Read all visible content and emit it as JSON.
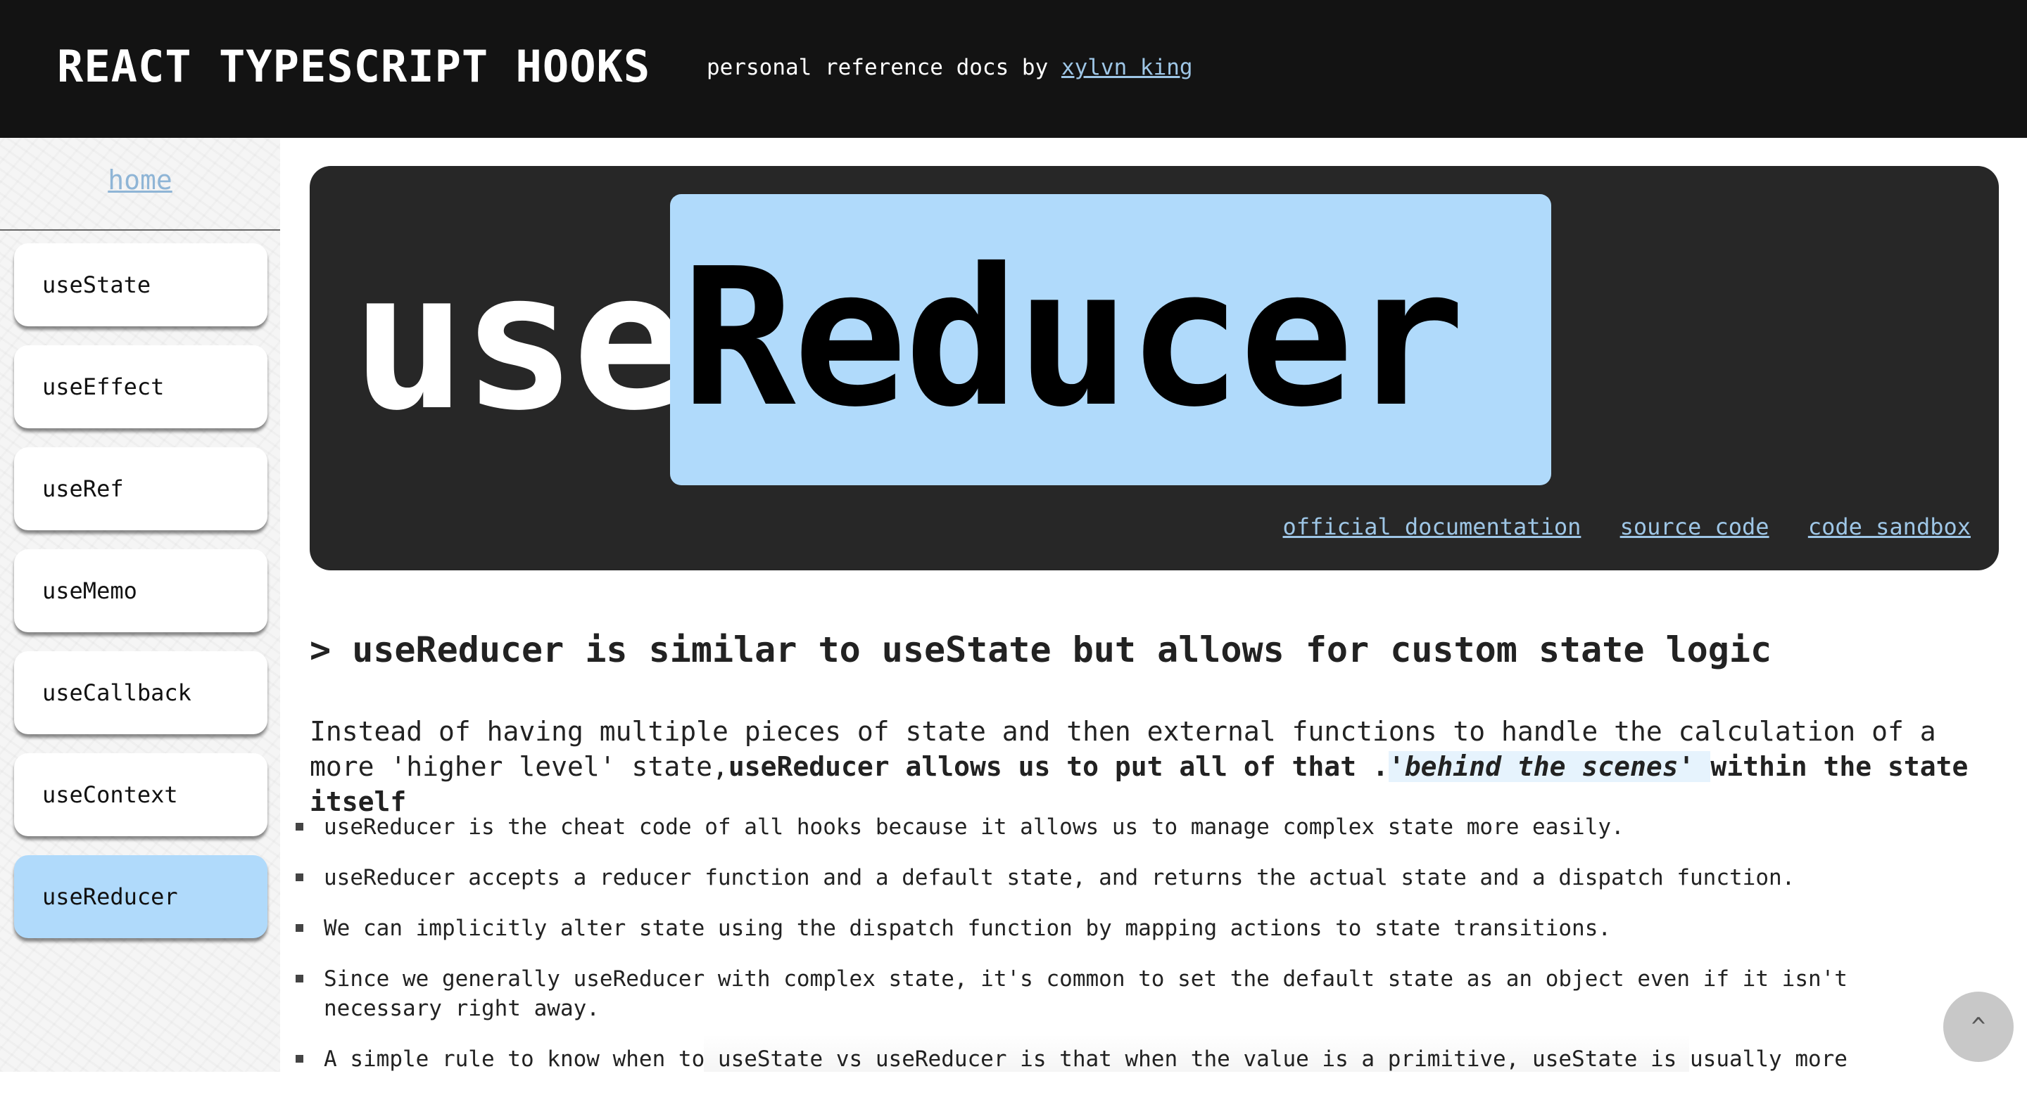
{
  "header": {
    "title": "REACT TYPESCRIPT HOOKS",
    "tagline_prefix": "personal reference docs by",
    "author_link": "xylvn king"
  },
  "sidebar": {
    "home_link": "home",
    "items": [
      {
        "label": "useState",
        "active": false
      },
      {
        "label": "useEffect",
        "active": false
      },
      {
        "label": "useRef",
        "active": false
      },
      {
        "label": "useMemo",
        "active": false
      },
      {
        "label": "useCallback",
        "active": false
      },
      {
        "label": "useContext",
        "active": false
      },
      {
        "label": "useReducer",
        "active": true
      }
    ]
  },
  "hero": {
    "prefix": "use",
    "name": "Reducer",
    "links": [
      "official documentation",
      "source code",
      "code sandbox"
    ]
  },
  "main": {
    "heading": "> useReducer is similar to useState but allows for custom state logic",
    "intro_plain": "Instead of having multiple pieces of state and then external functions to handle the calculation of a more 'higher level' state,",
    "intro_bold": "useReducer allows us to put all of that .",
    "intro_highlight": "'behind the scenes' ",
    "intro_bold_end": "within the state itself",
    "bullets": [
      "useReducer is the cheat code of all hooks because it allows us to manage complex state more easily.",
      "useReducer accepts a reducer function and a default state, and returns the actual state and a dispatch function.",
      "We can implicitly alter state using the dispatch function by mapping actions to state transitions.",
      "Since we generally useReducer with complex state, it's common to set the default state as an object even if it isn't necessary right away.",
      "A simple rule to know when to useState vs useReducer is that when the value is a primitive, useState is usually more"
    ]
  },
  "scroll_top_label": "^",
  "colors": {
    "topbar": "#131313",
    "accent": "#b0dafb",
    "link": "#9ec6e6",
    "hero_bg": "#272727"
  }
}
